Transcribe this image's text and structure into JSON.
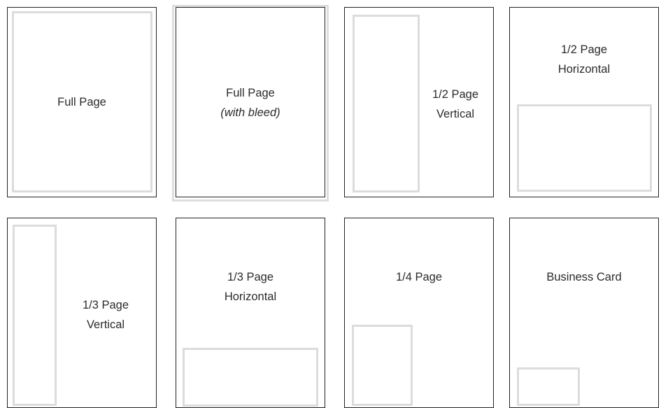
{
  "ad_sizes": [
    {
      "name": "full-page",
      "lines": [
        "Full Page"
      ],
      "subtitle": ""
    },
    {
      "name": "full-page-bleed",
      "lines": [
        "Full Page"
      ],
      "subtitle": "(with bleed)"
    },
    {
      "name": "half-page-vertical",
      "lines": [
        "1/2 Page",
        "Vertical"
      ],
      "subtitle": ""
    },
    {
      "name": "half-page-horizontal",
      "lines": [
        "1/2 Page",
        "Horizontal"
      ],
      "subtitle": ""
    },
    {
      "name": "third-page-vertical",
      "lines": [
        "1/3 Page",
        "Vertical"
      ],
      "subtitle": ""
    },
    {
      "name": "third-page-horizontal",
      "lines": [
        "1/3 Page",
        "Horizontal"
      ],
      "subtitle": ""
    },
    {
      "name": "quarter-page",
      "lines": [
        "1/4 Page"
      ],
      "subtitle": ""
    },
    {
      "name": "business-card",
      "lines": [
        "Business Card"
      ],
      "subtitle": ""
    }
  ],
  "colors": {
    "page_border": "#222222",
    "ad_area": "#dcdcdc",
    "text": "#2b2b2b"
  }
}
